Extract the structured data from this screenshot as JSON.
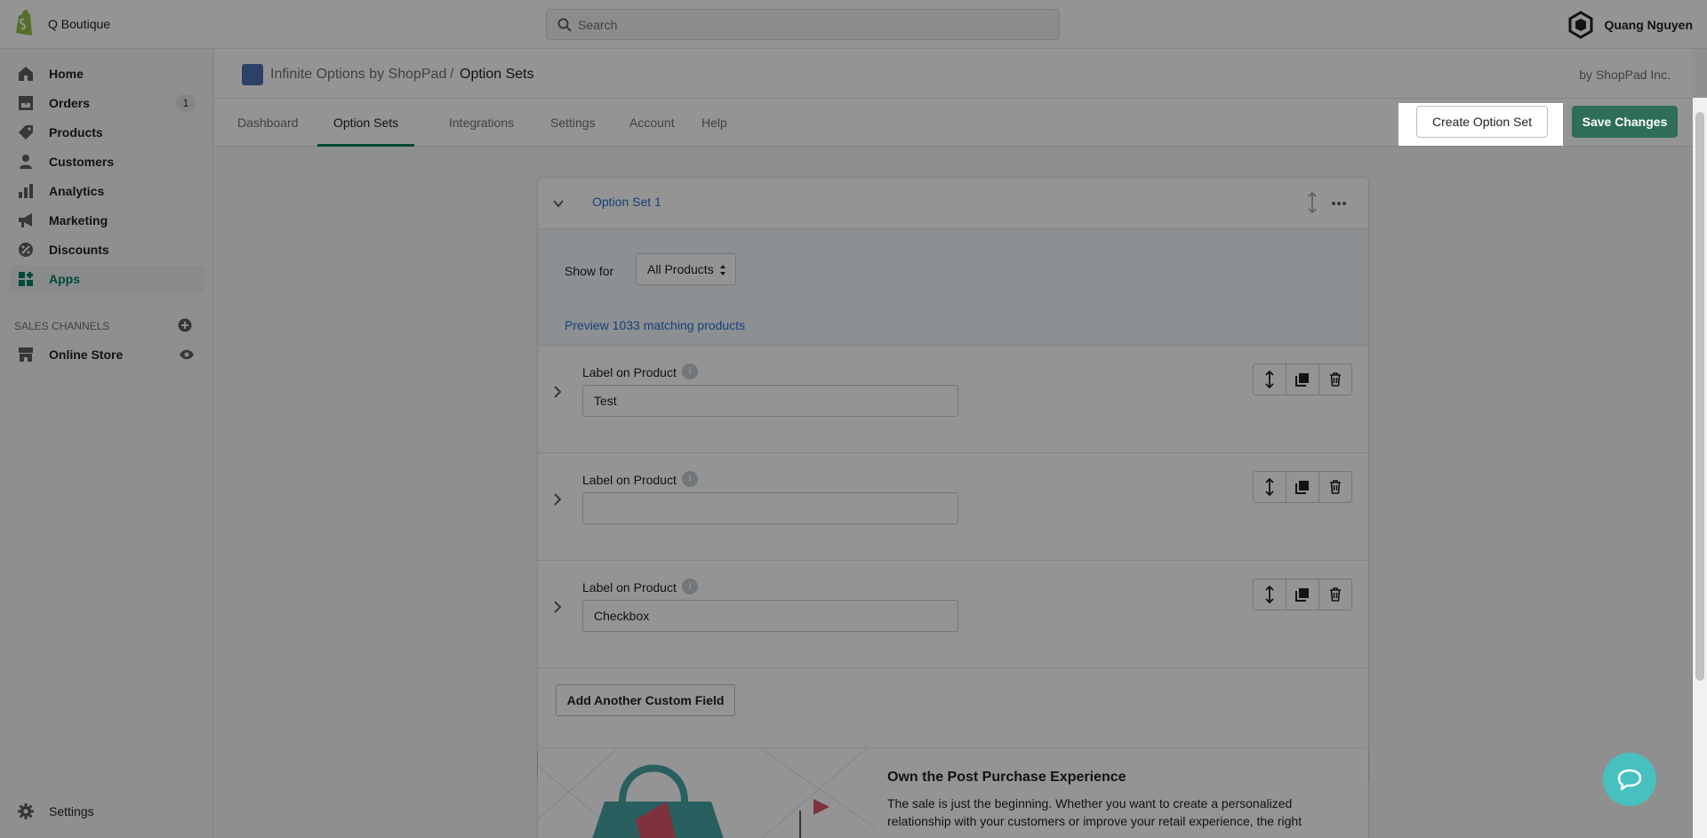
{
  "store_name": "Q Boutique",
  "search": {
    "placeholder": "Search"
  },
  "user": {
    "name": "Quang Nguyen"
  },
  "nav": {
    "items": [
      {
        "label": "Home"
      },
      {
        "label": "Orders",
        "badge": "1"
      },
      {
        "label": "Products"
      },
      {
        "label": "Customers"
      },
      {
        "label": "Analytics"
      },
      {
        "label": "Marketing"
      },
      {
        "label": "Discounts"
      },
      {
        "label": "Apps"
      }
    ],
    "sales_channels_title": "SALES CHANNELS",
    "online_store": "Online Store",
    "settings": "Settings"
  },
  "app": {
    "breadcrumb_app": "Infinite Options by ShopPad",
    "breadcrumb_sep": "/",
    "breadcrumb_page": "Option Sets",
    "by": "by ShopPad Inc."
  },
  "tabs": [
    {
      "label": "Dashboard"
    },
    {
      "label": "Option Sets"
    },
    {
      "label": "Integrations"
    },
    {
      "label": "Settings"
    },
    {
      "label": "Account"
    },
    {
      "label": "Help"
    }
  ],
  "actions": {
    "create": "Create Option Set",
    "save": "Save Changes"
  },
  "option_set": {
    "title": "Option Set 1",
    "show_for_label": "Show for",
    "show_for_value": "All Products",
    "preview_link": "Preview 1033 matching products",
    "fields": [
      {
        "label": "Label on Product",
        "value": "Test"
      },
      {
        "label": "Label on Product",
        "value": ""
      },
      {
        "label": "Label on Product",
        "value": "Checkbox"
      }
    ],
    "add_button": "Add Another Custom Field"
  },
  "promo": {
    "title": "Own the Post Purchase Experience",
    "text": "The sale is just the beginning. Whether you want to create a personalized relationship with your customers or improve your retail experience, the right"
  },
  "colors": {
    "accent": "#008060",
    "save": "#006e52",
    "link": "#2c6ecb",
    "chat": "#47c1bf"
  }
}
